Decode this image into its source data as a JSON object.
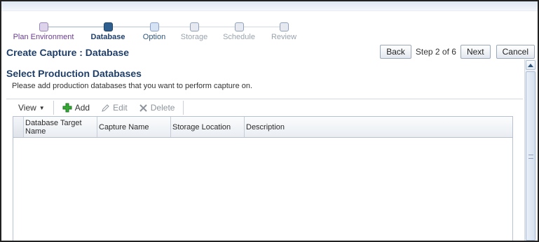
{
  "train": {
    "steps": [
      {
        "label": "Plan Environment",
        "state": "visited"
      },
      {
        "label": "Database",
        "state": "current"
      },
      {
        "label": "Option",
        "state": "next"
      },
      {
        "label": "Storage",
        "state": "future"
      },
      {
        "label": "Schedule",
        "state": "future"
      },
      {
        "label": "Review",
        "state": "future"
      }
    ]
  },
  "header": {
    "title": "Create Capture : Database",
    "back_label": "Back",
    "step_indicator": "Step 2 of 6",
    "next_label": "Next",
    "cancel_label": "Cancel"
  },
  "section": {
    "title": "Select Production Databases",
    "description": "Please add production databases that you want to perform capture on."
  },
  "toolbar": {
    "view_label": "View",
    "add_label": "Add",
    "edit_label": "Edit",
    "delete_label": "Delete"
  },
  "table": {
    "columns": [
      "Database Target Name",
      "Capture Name",
      "Storage Location",
      "Description"
    ],
    "rows": []
  },
  "colors": {
    "title": "#1f3f6a",
    "current_step": "#2f5f8f",
    "visited_step": "#6a3d8f",
    "add_icon": "#2e9b2e"
  }
}
